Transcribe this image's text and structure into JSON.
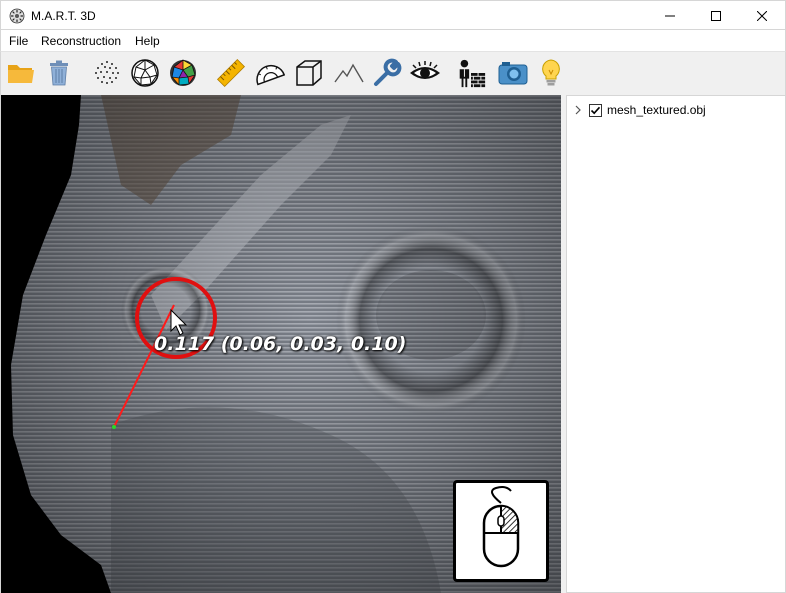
{
  "window": {
    "title": "M.A.R.T. 3D",
    "controls": [
      "minimize",
      "maximize",
      "close"
    ]
  },
  "menu": {
    "items": [
      {
        "label": "File"
      },
      {
        "label": "Reconstruction"
      },
      {
        "label": "Help"
      }
    ]
  },
  "toolbar": {
    "buttons": [
      {
        "icon": "open-folder-icon"
      },
      {
        "icon": "trash-icon"
      },
      {
        "icon": "point-cloud-icon"
      },
      {
        "icon": "wireframe-mesh-icon"
      },
      {
        "icon": "colored-mesh-icon"
      },
      {
        "icon": "ruler-icon"
      },
      {
        "icon": "protractor-icon"
      },
      {
        "icon": "cube-icon"
      },
      {
        "icon": "terrain-icon"
      },
      {
        "icon": "wrench-icon"
      },
      {
        "icon": "eye-icon"
      },
      {
        "icon": "construction-worker-icon"
      },
      {
        "icon": "camera-icon"
      },
      {
        "icon": "lightbulb-icon"
      }
    ]
  },
  "viewport": {
    "measurement_text": "0.117 (0.06, 0.03, 0.10)",
    "highlight_color": "#e01010",
    "mouse_hint_icon": "mouse-right-click-icon"
  },
  "tree": {
    "items": [
      {
        "label": "mesh_textured.obj",
        "checked": true,
        "expanded": false
      }
    ]
  }
}
